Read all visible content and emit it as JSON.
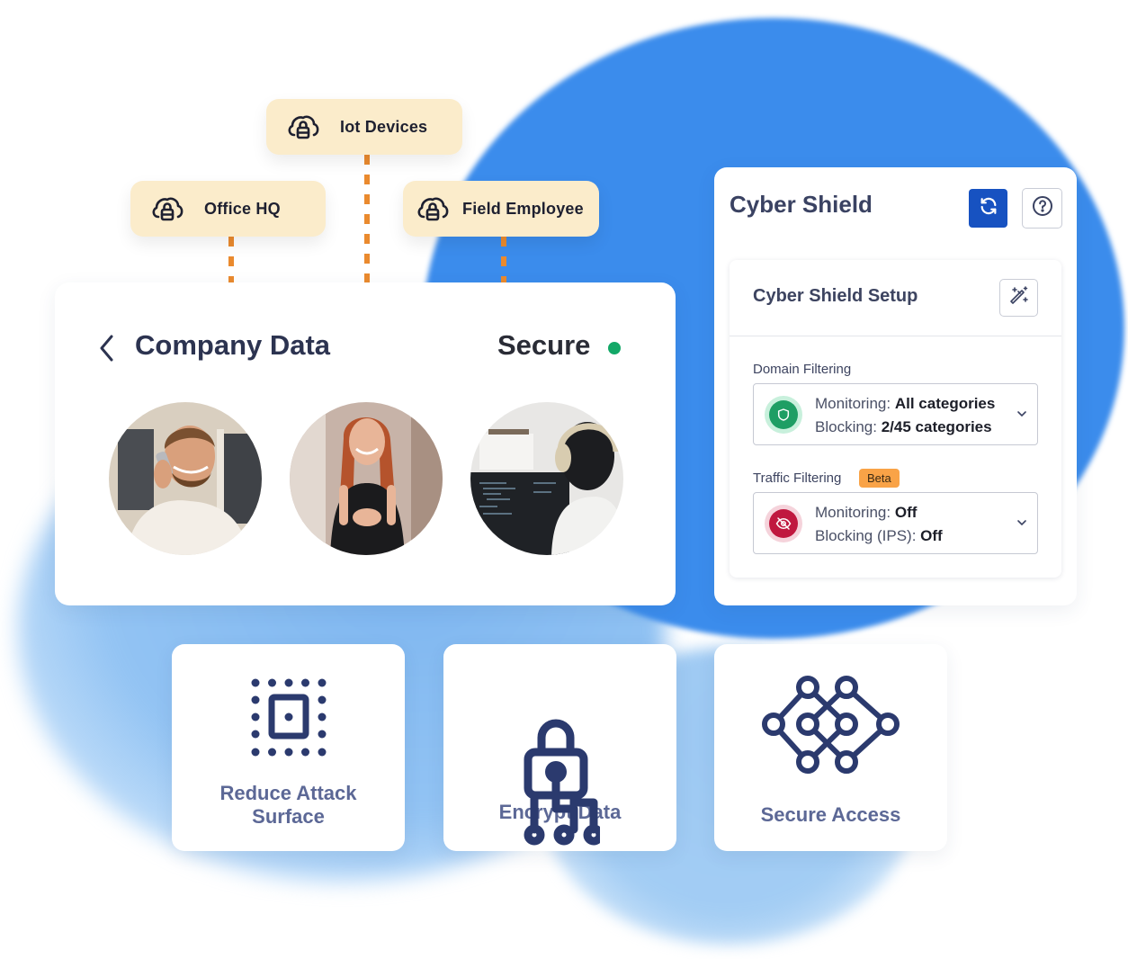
{
  "chips": [
    {
      "label": "Iot Devices",
      "icon": "cloud-lock-icon"
    },
    {
      "label": "Office HQ",
      "icon": "cloud-lock-icon"
    },
    {
      "label": "Field Employee",
      "icon": "cloud-lock-icon"
    }
  ],
  "company_card": {
    "back_icon": "chevron-left-icon",
    "title": "Company Data",
    "status": "Secure",
    "status_color": "#13a867",
    "people": [
      {
        "description": "Man smiling on phone call"
      },
      {
        "description": "Red-haired woman smiling"
      },
      {
        "description": "Person with headphones at code monitor"
      }
    ]
  },
  "cyber_shield": {
    "title": "Cyber Shield",
    "refresh_icon": "refresh-icon",
    "help_icon": "help-circle-icon",
    "accent_color": "#1752c1",
    "setup": {
      "title": "Cyber Shield Setup",
      "wand_icon": "magic-wand-icon",
      "domain_filtering": {
        "label": "Domain Filtering",
        "icon": "shield-icon",
        "status_color": "#1e9e64",
        "monitoring_label": "Monitoring:",
        "monitoring_value": "All categories",
        "blocking_label": "Blocking:",
        "blocking_value": "2/45 categories"
      },
      "traffic_filtering": {
        "label": "Traffic Filtering",
        "badge": "Beta",
        "icon": "eye-off-icon",
        "status_color": "#c0183f",
        "monitoring_label": "Monitoring:",
        "monitoring_value": "Off",
        "blocking_label": "Blocking (IPS):",
        "blocking_value": "Off"
      }
    }
  },
  "features": [
    {
      "label_line1": "Reduce Attack",
      "label_line2": "Surface",
      "icon": "attack-surface-icon"
    },
    {
      "label_line1": "Encrypt Data",
      "icon": "lock-network-icon"
    },
    {
      "label_line1": "Secure Access",
      "icon": "network-nodes-icon"
    }
  ]
}
